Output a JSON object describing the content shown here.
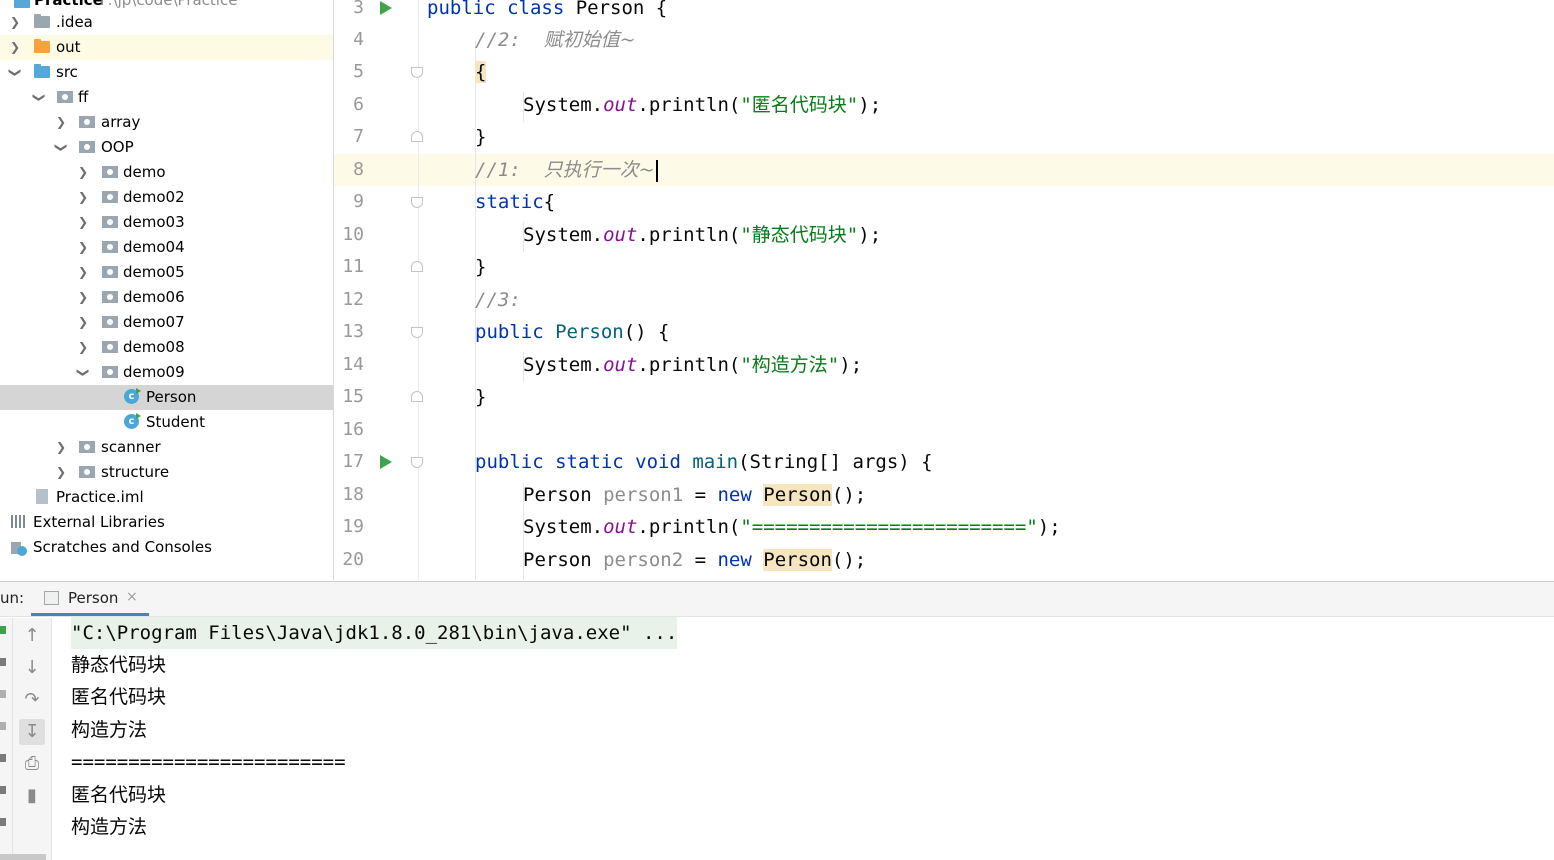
{
  "project_tree": {
    "root": {
      "label": "Practice",
      "path": "F:\\jp\\code\\Practice"
    },
    "items": [
      {
        "label": ".idea",
        "icon": "folder-icon"
      },
      {
        "label": "out",
        "icon": "folder-orange-icon"
      },
      {
        "label": "src",
        "icon": "folder-source-icon"
      },
      {
        "label": "ff",
        "icon": "package-icon"
      },
      {
        "label": "array",
        "icon": "package-icon"
      },
      {
        "label": "OOP",
        "icon": "package-icon"
      },
      {
        "label": "demo",
        "icon": "package-icon"
      },
      {
        "label": "demo02",
        "icon": "package-icon"
      },
      {
        "label": "demo03",
        "icon": "package-icon"
      },
      {
        "label": "demo04",
        "icon": "package-icon"
      },
      {
        "label": "demo05",
        "icon": "package-icon"
      },
      {
        "label": "demo06",
        "icon": "package-icon"
      },
      {
        "label": "demo07",
        "icon": "package-icon"
      },
      {
        "label": "demo08",
        "icon": "package-icon"
      },
      {
        "label": "demo09",
        "icon": "package-icon"
      },
      {
        "label": "Person",
        "icon": "java-class-icon"
      },
      {
        "label": "Student",
        "icon": "java-class-icon"
      },
      {
        "label": "scanner",
        "icon": "package-icon"
      },
      {
        "label": "structure",
        "icon": "package-icon"
      },
      {
        "label": "Practice.iml",
        "icon": "iml-file-icon"
      },
      {
        "label": "External Libraries",
        "icon": "libraries-icon"
      },
      {
        "label": "Scratches and Consoles",
        "icon": "scratches-icon"
      }
    ],
    "selected": "Person"
  },
  "editor": {
    "line_numbers": [
      "3",
      "4",
      "5",
      "6",
      "7",
      "8",
      "9",
      "10",
      "11",
      "12",
      "13",
      "14",
      "15",
      "16",
      "17",
      "18",
      "19",
      "20"
    ],
    "code": {
      "l3": {
        "kw": "public class",
        "rest": " Person {"
      },
      "l4": {
        "comment": "//2:  ",
        "comment_zh": "赋初始值~"
      },
      "l5": {
        "brace": "{"
      },
      "l6": {
        "pre": "System.",
        "field": "out",
        "mid": ".println(",
        "str": "\"匿名代码块\"",
        "end": ");"
      },
      "l7": {
        "brace": "}"
      },
      "l8": {
        "comment": "//1:  ",
        "comment_zh": "只执行一次~"
      },
      "l9": {
        "kw": "static",
        "rest": "{"
      },
      "l10": {
        "pre": "System.",
        "field": "out",
        "mid": ".println(",
        "str": "\"静态代码块\"",
        "end": ");"
      },
      "l11": {
        "brace": "}"
      },
      "l12": {
        "comment": "//3:"
      },
      "l13": {
        "kw": "public",
        "name": " Person",
        "rest": "() {"
      },
      "l14": {
        "pre": "System.",
        "field": "out",
        "mid": ".println(",
        "str": "\"构造方法\"",
        "end": ");"
      },
      "l15": {
        "brace": "}"
      },
      "l17": {
        "kw": "public static void",
        "name": " main",
        "rest": "(String[] args) {"
      },
      "l18": {
        "type": "Person ",
        "var": "person1",
        "eq": " = ",
        "kw": "new",
        "sp": " ",
        "ctor": "Person",
        "end": "();"
      },
      "l19": {
        "pre": "System.",
        "field": "out",
        "mid": ".println(",
        "str": "\"========================\"",
        "end": ");"
      },
      "l20": {
        "type": "Person ",
        "var": "person2",
        "eq": " = ",
        "kw": "new",
        "sp": " ",
        "ctor": "Person",
        "end": "();"
      }
    }
  },
  "run_panel": {
    "label": "un:",
    "tab": "Person",
    "tab_close": "×",
    "output": [
      "\"C:\\Program Files\\Java\\jdk1.8.0_281\\bin\\java.exe\" ...",
      "静态代码块",
      "匿名代码块",
      "构造方法",
      "========================",
      "匿名代码块",
      "构造方法"
    ],
    "tools": [
      "up-arrow-icon",
      "down-arrow-icon",
      "soft-wrap-icon",
      "scroll-to-end-icon",
      "print-icon",
      "trash-icon"
    ]
  },
  "colors": {
    "keyword": "#0033b3",
    "string": "#067d17",
    "comment": "#8c8c8c",
    "field": "#871094",
    "run_green": "#3ea34a",
    "selection": "#d5d5d5"
  }
}
